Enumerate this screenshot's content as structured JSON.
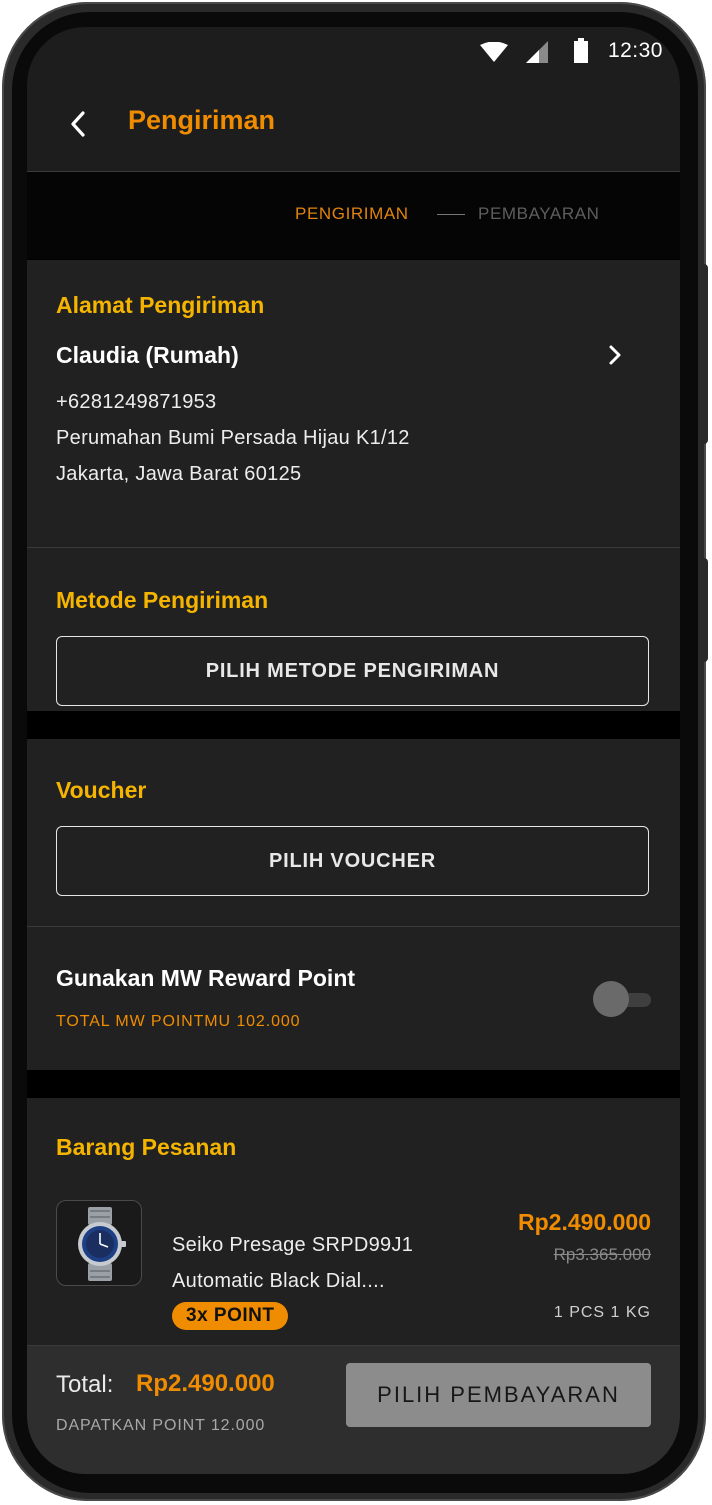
{
  "status_bar": {
    "time": "12:30"
  },
  "header": {
    "title": "Pengiriman"
  },
  "steps": [
    {
      "label": "PENGIRIMAN",
      "active": true
    },
    {
      "label": "PEMBAYARAN",
      "active": false
    }
  ],
  "address": {
    "section_title": "Alamat Pengiriman",
    "name": "Claudia (Rumah)",
    "phone": "+6281249871953",
    "line1": "Perumahan Bumi Persada Hijau K1/12",
    "line2": "Jakarta, Jawa Barat 60125"
  },
  "shipping": {
    "section_title": "Metode Pengiriman",
    "button_label": "PILIH METODE PENGIRIMAN"
  },
  "voucher": {
    "section_title": "Voucher",
    "button_label": "PILIH VOUCHER"
  },
  "reward": {
    "title": "Gunakan MW Reward Point",
    "subtitle": "TOTAL MW POINTMU 102.000",
    "enabled": false
  },
  "order": {
    "section_title": "Barang Pesanan",
    "items": [
      {
        "name_line1": "Seiko Presage SRPD99J1",
        "name_line2": "Automatic Black Dial....",
        "price": "Rp2.490.000",
        "old_price": "Rp3.365.000",
        "qty": "1 PCS 1 KG",
        "badge": "3x POINT"
      }
    ]
  },
  "footer": {
    "total_label": "Total:",
    "total_value": "Rp2.490.000",
    "earn_points": "DAPATKAN POINT 12.000",
    "button_label": "PILIH PEMBAYARAN"
  },
  "colors": {
    "accent_orange": "#f08c00",
    "section_yellow": "#f5b400",
    "card_bg": "#212121",
    "screen_bg": "#000000"
  }
}
